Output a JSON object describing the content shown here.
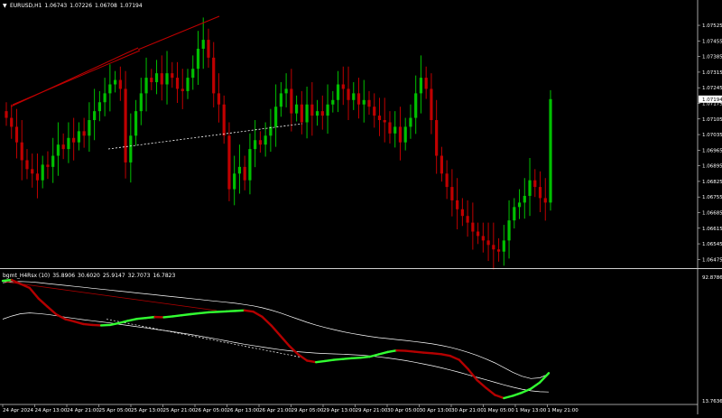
{
  "main_header": {
    "symbol": "EURUSD,H1",
    "open": "1.06743",
    "high": "1.07226",
    "low": "1.06708",
    "close": "1.07194"
  },
  "indicator_header": {
    "name": "bgmt_H4Rsx (10)",
    "values": [
      "35.8906",
      "30.6020",
      "25.9147",
      "32.7073",
      "16.7823"
    ]
  },
  "colors": {
    "background": "#000000",
    "bull_candle": "#00c000",
    "bear_candle": "#c00000",
    "trendline": "#c00000",
    "rsx_up": "#32ff32",
    "rsx_down": "#b40000",
    "bands": "#ffffff",
    "price_tag_bg": "#ffffff"
  },
  "chart_data": [
    {
      "type": "candlestick",
      "name": "EURUSD,H1",
      "price_axis_ticks": [
        "1.07525",
        "1.07455",
        "1.07385",
        "1.07315",
        "1.07245",
        "1.07175",
        "1.07105",
        "1.07035",
        "1.06965",
        "1.06895",
        "1.06825",
        "1.06755",
        "1.06685",
        "1.06615",
        "1.06545",
        "1.06475"
      ],
      "current_price": "1.07194",
      "ylim": [
        1.0644,
        1.0759
      ],
      "series_close": [
        1.0711,
        1.0707,
        1.07,
        1.0692,
        1.0688,
        1.0686,
        1.0683,
        1.069,
        1.0689,
        1.0694,
        1.0699,
        1.0697,
        1.0702,
        1.07,
        1.0705,
        1.0703,
        1.071,
        1.0714,
        1.0718,
        1.0722,
        1.0726,
        1.0728,
        1.0724,
        1.0691,
        1.0703,
        1.0714,
        1.0722,
        1.0729,
        1.0727,
        1.0731,
        1.0726,
        1.0731,
        1.0729,
        1.0724,
        1.0723,
        1.0729,
        1.0733,
        1.0742,
        1.0746,
        1.0738,
        1.0722,
        1.0717,
        1.0703,
        1.0679,
        1.0686,
        1.0689,
        1.0683,
        1.0697,
        1.0701,
        1.0699,
        1.0703,
        1.0707,
        1.0716,
        1.0722,
        1.0724,
        1.0713,
        1.0717,
        1.0709,
        1.0717,
        1.0712,
        1.0714,
        1.0712,
        1.0717,
        1.0719,
        1.0726,
        1.0724,
        1.0719,
        1.0722,
        1.0717,
        1.0719,
        1.0716,
        1.0712,
        1.071,
        1.0709,
        1.0704,
        1.0707,
        1.07,
        1.0707,
        1.0711,
        1.0722,
        1.0729,
        1.0724,
        1.071,
        1.0694,
        1.0686,
        1.068,
        1.0674,
        1.067,
        1.0667,
        1.0664,
        1.066,
        1.0658,
        1.0656,
        1.0654,
        1.0652,
        1.0651,
        1.0656,
        1.0665,
        1.0671,
        1.0673,
        1.0676,
        1.0683,
        1.068,
        1.0675,
        1.0673,
        1.07194
      ],
      "dates": [
        "24 Apr 2024",
        "24 Apr 13:00",
        "24 Apr 21:00",
        "25 Apr 05:00",
        "25 Apr 13:00",
        "25 Apr 21:00",
        "26 Apr 05:00",
        "26 Apr 13:00",
        "26 Apr 21:00",
        "29 Apr 05:00",
        "29 Apr 13:00",
        "29 Apr 21:00",
        "30 Apr 05:00",
        "30 Apr 13:00",
        "30 Apr 21:00",
        "1 May 05:00",
        "1 May 13:00",
        "1 May 21:00"
      ]
    },
    {
      "type": "line",
      "name": "bgmt_H4Rsx (10)",
      "axis_ticks": [
        "92.8786",
        "13.7636"
      ],
      "ylim": [
        13.7636,
        92.8786
      ],
      "rsx": [
        90.5,
        91.1,
        88.5,
        86.0,
        79.2,
        74.0,
        69.0,
        66.0,
        64.5,
        62.9,
        62.3,
        62.0,
        62.3,
        63.5,
        65.0,
        66.2,
        66.8,
        67.4,
        67.2,
        67.8,
        68.5,
        69.2,
        69.8,
        70.4,
        70.7,
        71.0,
        71.3,
        71.6,
        70.8,
        67.5,
        62.0,
        55.5,
        49.0,
        43.5,
        39.5,
        38.5,
        39.2,
        40.0,
        40.5,
        41.0,
        41.4,
        42.0,
        43.5,
        45.0,
        46.0,
        45.8,
        45.2,
        44.6,
        44.2,
        43.6,
        42.5,
        40.0,
        34.0,
        27.0,
        22.0,
        17.5,
        15.5,
        17.0,
        19.0,
        21.5,
        25.5,
        31.5
      ],
      "upper_band": [
        89.3,
        90.0,
        90.1,
        89.9,
        89.4,
        88.8,
        88.2,
        87.6,
        87.0,
        86.4,
        85.8,
        85.2,
        84.6,
        84.0,
        83.4,
        82.8,
        82.2,
        81.6,
        81.0,
        80.4,
        79.8,
        79.2,
        78.6,
        78.0,
        77.4,
        76.8,
        76.2,
        75.4,
        74.5,
        73.3,
        71.8,
        70.0,
        68.0,
        66.0,
        64.0,
        62.2,
        60.7,
        59.3,
        58.0,
        56.9,
        55.9,
        55.0,
        54.2,
        53.6,
        53.0,
        52.4,
        51.7,
        51.0,
        50.2,
        49.2,
        48.0,
        46.5,
        44.8,
        42.8,
        40.5,
        38.0,
        35.0,
        32.0,
        29.5,
        28.0,
        28.5,
        31.0
      ],
      "lower_band": [
        66.0,
        68.0,
        69.5,
        70.0,
        69.6,
        69.0,
        68.2,
        67.3,
        66.5,
        65.7,
        65.0,
        64.3,
        63.6,
        62.8,
        62.0,
        61.2,
        60.4,
        59.6,
        58.8,
        58.0,
        57.1,
        56.2,
        55.2,
        54.2,
        53.2,
        52.1,
        51.0,
        50.0,
        49.1,
        48.2,
        47.3,
        46.5,
        45.8,
        45.2,
        44.7,
        44.3,
        44.0,
        43.8,
        43.6,
        43.3,
        43.0,
        42.5,
        41.9,
        41.2,
        40.4,
        39.5,
        38.5,
        37.4,
        36.2,
        34.9,
        33.5,
        32.0,
        30.4,
        28.8,
        27.2,
        25.6,
        24.0,
        22.5,
        21.2,
        20.2,
        19.6,
        19.4
      ],
      "dates": [
        "24 Apr 2024",
        "24 Apr 13:00",
        "24 Apr 21:00",
        "25 Apr 05:00",
        "25 Apr 13:00",
        "25 Apr 21:00",
        "26 Apr 05:00",
        "26 Apr 13:00",
        "26 Apr 21:00",
        "29 Apr 05:00",
        "29 Apr 13:00",
        "29 Apr 21:00",
        "30 Apr 05:00",
        "30 Apr 13:00",
        "30 Apr 21:00",
        "1 May 05:00",
        "1 May 13:00",
        "1 May 21:00"
      ]
    }
  ]
}
